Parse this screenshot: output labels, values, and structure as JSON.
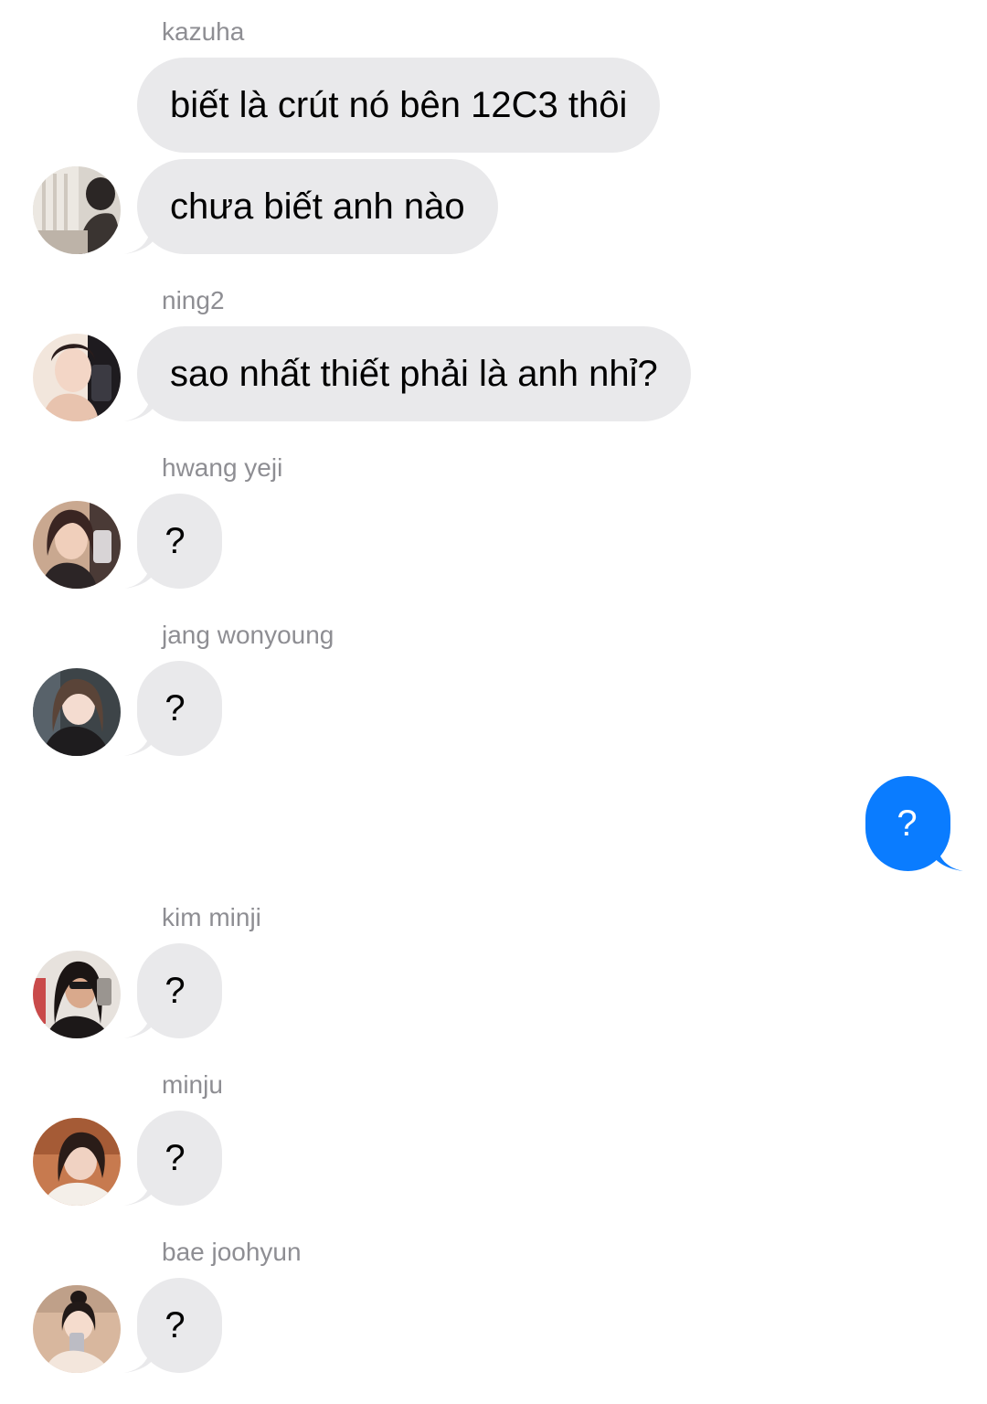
{
  "messages": [
    {
      "sender": "kazuha",
      "text": "biết là crút nó bên 12C3 thôi"
    },
    {
      "text": "chưa biết anh nào"
    },
    {
      "sender": "ning2",
      "text": "sao nhất thiết phải là anh nhỉ?"
    },
    {
      "sender": "hwang yeji",
      "text": "?"
    },
    {
      "sender": "jang wonyoung",
      "text": "?"
    },
    {
      "outgoing": true,
      "text": "?"
    },
    {
      "sender": "kim minji",
      "text": "?"
    },
    {
      "sender": "minju",
      "text": "?"
    },
    {
      "sender": "bae joohyun",
      "text": "?"
    }
  ],
  "colors": {
    "incoming_bubble": "#e9e9eb",
    "outgoing_bubble": "#0a7cff",
    "sender_name": "#8e8e93",
    "background": "#ffffff"
  }
}
